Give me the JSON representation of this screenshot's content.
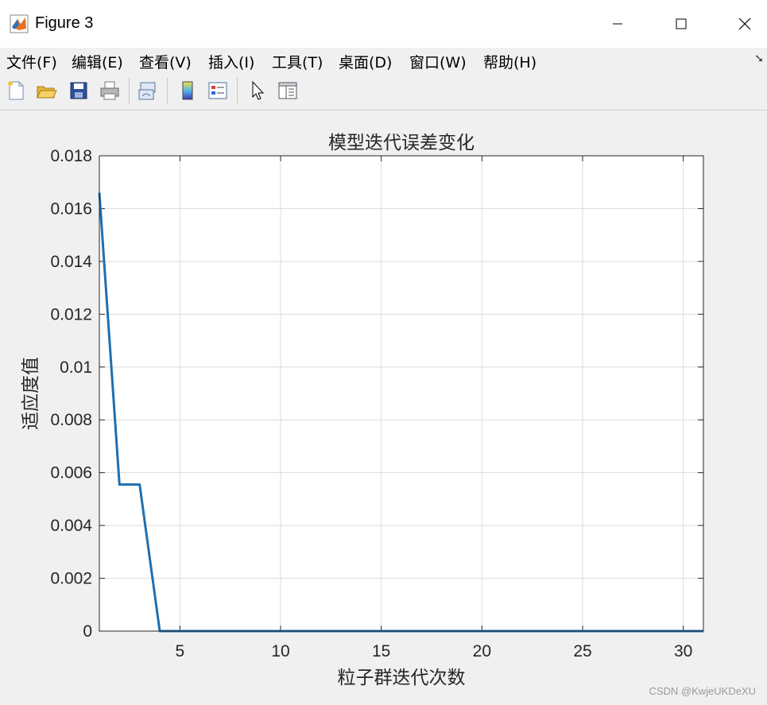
{
  "window": {
    "title": "Figure 3"
  },
  "menu": {
    "items": [
      "文件(F)",
      "编辑(E)",
      "查看(V)",
      "插入(I)",
      "工具(T)",
      "桌面(D)",
      "窗口(W)",
      "帮助(H)"
    ]
  },
  "toolbar": {
    "icons": [
      "new-figure-icon",
      "open-icon",
      "save-icon",
      "print-icon",
      "link-plot-icon",
      "colorbar-icon",
      "legend-icon",
      "pointer-icon",
      "property-editor-icon"
    ]
  },
  "chart_data": {
    "type": "line",
    "title": "模型迭代误差变化",
    "xlabel": "粒子群迭代次数",
    "ylabel": "适应度值",
    "xlim": [
      1,
      31
    ],
    "ylim": [
      0,
      0.018
    ],
    "xticks": [
      5,
      10,
      15,
      20,
      25,
      30
    ],
    "yticks": [
      0,
      0.002,
      0.004,
      0.006,
      0.008,
      0.01,
      0.012,
      0.014,
      0.016,
      0.018
    ],
    "ytick_labels": [
      "0",
      "0.002",
      "0.004",
      "0.006",
      "0.008",
      "0.01",
      "0.012",
      "0.014",
      "0.016",
      "0.018"
    ],
    "grid": true,
    "line_color": "#1f6fb0",
    "x": [
      1,
      2,
      3,
      4,
      5,
      6,
      7,
      8,
      9,
      10,
      11,
      12,
      13,
      14,
      15,
      16,
      17,
      18,
      19,
      20,
      21,
      22,
      23,
      24,
      25,
      26,
      27,
      28,
      29,
      30,
      31
    ],
    "y": [
      0.0166,
      0.00555,
      0.00555,
      0,
      0,
      0,
      0,
      0,
      0,
      0,
      0,
      0,
      0,
      0,
      0,
      0,
      0,
      0,
      0,
      0,
      0,
      0,
      0,
      0,
      0,
      0,
      0,
      0,
      0,
      0,
      0
    ]
  },
  "watermark": "CSDN @KwjeUKDeXU"
}
